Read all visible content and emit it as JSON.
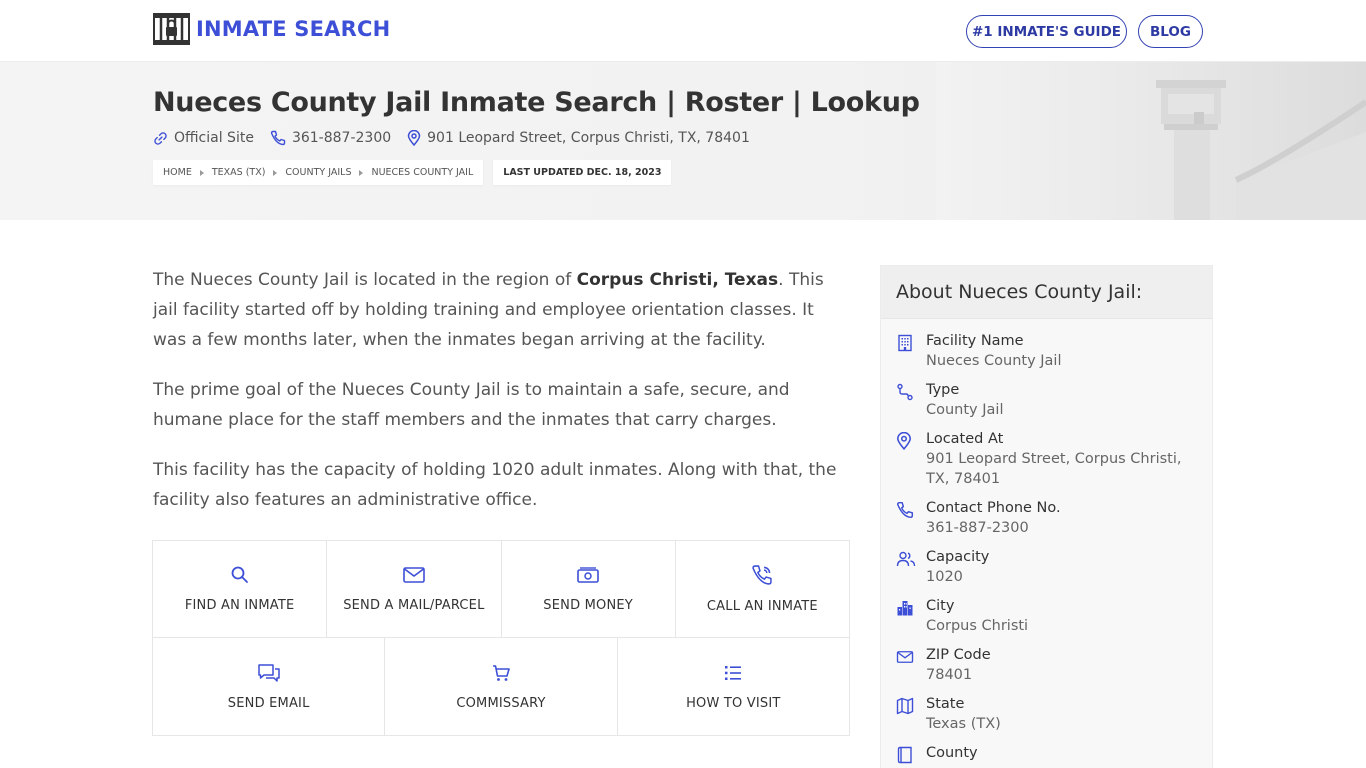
{
  "brand": {
    "name": "INMATE SEARCH",
    "accent": "#3d4fd6"
  },
  "nav": {
    "guide_label": "#1 INMATE'S GUIDE",
    "blog_label": "BLOG"
  },
  "hero": {
    "title": "Nueces County Jail Inmate Search | Roster | Lookup",
    "official_site": "Official Site",
    "phone": "361-887-2300",
    "address": "901 Leopard Street, Corpus Christi, TX, 78401",
    "breadcrumbs": [
      "HOME",
      "TEXAS (TX)",
      "COUNTY JAILS",
      "NUECES COUNTY JAIL"
    ],
    "last_updated": "LAST UPDATED DEC. 18, 2023"
  },
  "content": {
    "p1_a": "The Nueces County Jail is located in the region of ",
    "p1_bold": "Corpus Christi, Texas",
    "p1_b": ". This jail facility started off by holding training and employee orientation classes. It was a few months later, when the inmates began arriving at the facility.",
    "p2": "The prime goal of the Nueces County Jail is to maintain a safe, secure, and humane place for the staff members and the inmates that carry charges.",
    "p3": "This facility has the capacity of holding 1020 adult inmates. Along with that, the facility also features an administrative office."
  },
  "actions": [
    {
      "label": "FIND AN INMATE",
      "icon": "search-icon"
    },
    {
      "label": "SEND A MAIL/PARCEL",
      "icon": "mail-icon"
    },
    {
      "label": "SEND MONEY",
      "icon": "money-icon"
    },
    {
      "label": "CALL AN INMATE",
      "icon": "phone-icon"
    },
    {
      "label": "SEND EMAIL",
      "icon": "chat-icon"
    },
    {
      "label": "COMMISSARY",
      "icon": "cart-icon"
    },
    {
      "label": "HOW TO VISIT",
      "icon": "list-icon"
    }
  ],
  "sidebar": {
    "title": "About Nueces County Jail:",
    "items": [
      {
        "label": "Facility Name",
        "value": "Nueces County Jail",
        "icon": "building-icon"
      },
      {
        "label": "Type",
        "value": "County Jail",
        "icon": "route-icon"
      },
      {
        "label": "Located At",
        "value": "901 Leopard Street, Corpus Christi, TX, 78401",
        "icon": "pin-icon"
      },
      {
        "label": "Contact Phone No.",
        "value": "361-887-2300",
        "icon": "phone-icon"
      },
      {
        "label": "Capacity",
        "value": "1020",
        "icon": "users-icon"
      },
      {
        "label": "City",
        "value": "Corpus Christi",
        "icon": "city-icon"
      },
      {
        "label": "ZIP Code",
        "value": "78401",
        "icon": "mail-icon"
      },
      {
        "label": "State",
        "value": "Texas (TX)",
        "icon": "map-icon"
      },
      {
        "label": "County",
        "value": "",
        "icon": "book-icon"
      }
    ]
  }
}
